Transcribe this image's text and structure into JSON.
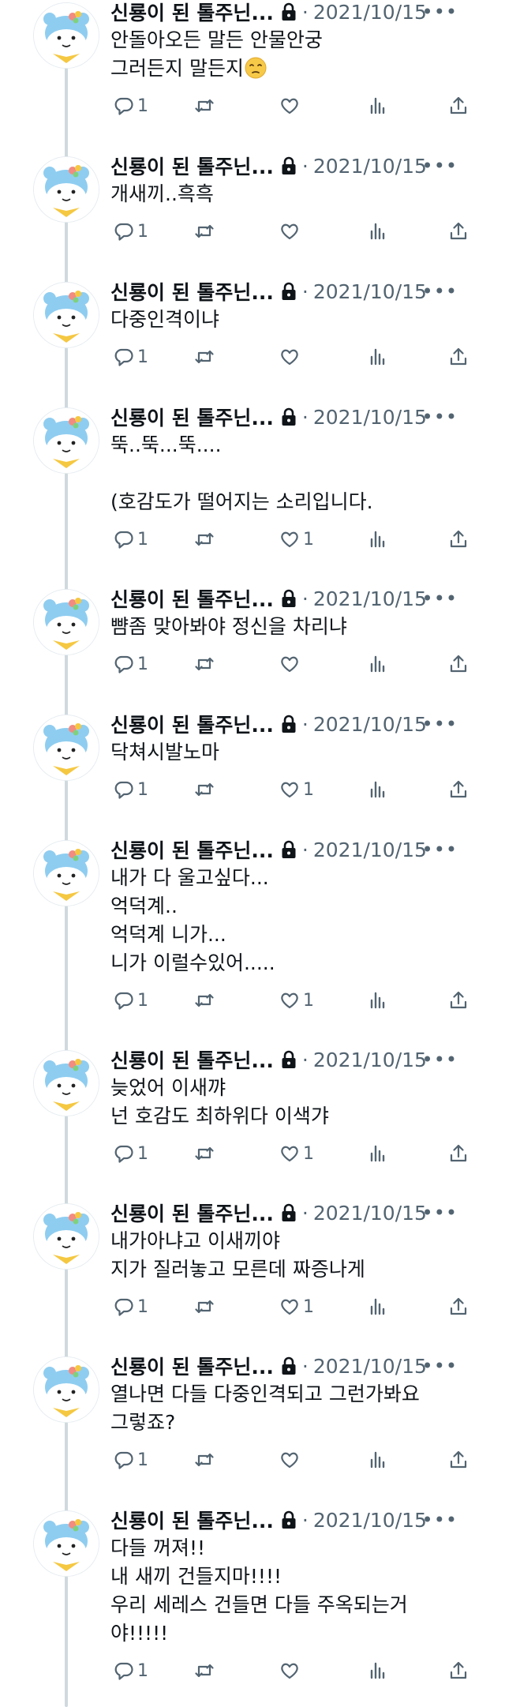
{
  "tweets": [
    {
      "name": "신룡이 된 톨주닌...",
      "date": "2021/10/15",
      "text": "안돌아오든 말든 안물안궁\n그러든지 말든지",
      "emoji": "pensive-face",
      "reply_count": "1",
      "like_count": ""
    },
    {
      "name": "신룡이 된 톨주닌...",
      "date": "2021/10/15",
      "text": "개새끼..흑흑",
      "reply_count": "1",
      "like_count": ""
    },
    {
      "name": "신룡이 된 톨주닌...",
      "date": "2021/10/15",
      "text": "다중인격이냐",
      "reply_count": "1",
      "like_count": ""
    },
    {
      "name": "신룡이 된 톨주닌...",
      "date": "2021/10/15",
      "text": "뚝..뚝...뚝....\n\n(호감도가 떨어지는 소리입니다.",
      "reply_count": "1",
      "like_count": "1"
    },
    {
      "name": "신룡이 된 톨주닌...",
      "date": "2021/10/15",
      "text": "뺨좀 맞아봐야 정신을 차리냐",
      "reply_count": "1",
      "like_count": ""
    },
    {
      "name": "신룡이 된 톨주닌...",
      "date": "2021/10/15",
      "text": "닥쳐시발노마",
      "reply_count": "1",
      "like_count": "1"
    },
    {
      "name": "신룡이 된 톨주닌...",
      "date": "2021/10/15",
      "text": "내가 다 울고싶다...\n억덕계..\n억덕계 니가...\n니가 이럴수있어.....",
      "reply_count": "1",
      "like_count": "1"
    },
    {
      "name": "신룡이 된 톨주닌...",
      "date": "2021/10/15",
      "text": "늦었어 이새꺄\n넌 호감도 최하위다 이색갸",
      "reply_count": "1",
      "like_count": "1"
    },
    {
      "name": "신룡이 된 톨주닌...",
      "date": "2021/10/15",
      "text": "내가아냐고 이새끼야\n지가 질러놓고 모른데 짜증나게",
      "reply_count": "1",
      "like_count": "1"
    },
    {
      "name": "신룡이 된 톨주닌...",
      "date": "2021/10/15",
      "text": "열나면 다들 다중인격되고 그런가봐요\n그렇죠?",
      "reply_count": "1",
      "like_count": ""
    },
    {
      "name": "신룡이 된 톨주닌...",
      "date": "2021/10/15",
      "text": "다들 꺼져!!\n내 새끼 건들지마!!!!\n우리 세레스 건들면 다들 주옥되는거\n야!!!!!",
      "reply_count": "1",
      "like_count": ""
    }
  ],
  "separator": "·",
  "more_glyph": "•••",
  "icons": {
    "avatar": "mascot-avatar",
    "lock": "lock-icon",
    "reply": "reply-icon",
    "retweet": "retweet-icon",
    "like": "heart-icon",
    "views": "views-icon",
    "share": "share-icon",
    "more": "more-icon"
  },
  "colors": {
    "text": "#0f1419",
    "muted": "#536471",
    "thread_line": "#cfd9de",
    "avatar_blue": "#8fcdf0",
    "scarf": "#f5c842"
  }
}
